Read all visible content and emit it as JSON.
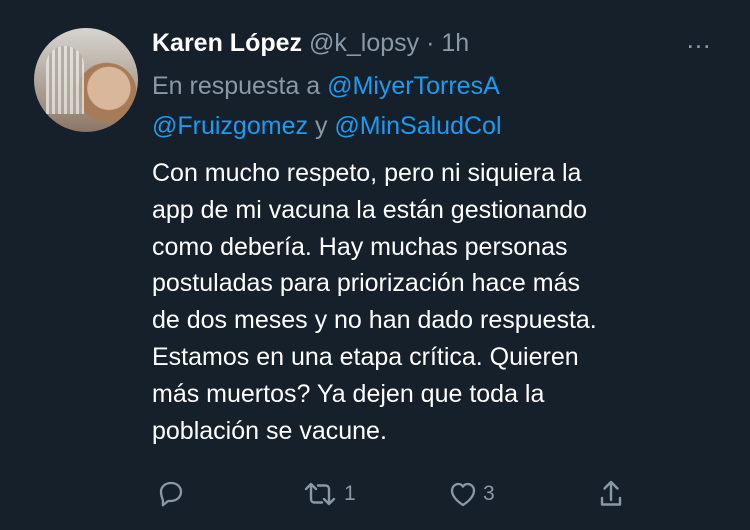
{
  "author": {
    "name": "Karen López",
    "handle": "@k_lopsy",
    "separator": "·",
    "time": "1h"
  },
  "reply_context": {
    "prefix": "En respuesta a",
    "mentions": [
      "@MiyerTorresA",
      "@Fruizgomez",
      "@MinSaludCol"
    ],
    "conjunction": "y"
  },
  "tweet_lines": [
    "Con mucho respeto, pero ni siquiera la",
    "app de mi vacuna la están gestionando",
    "como debería. Hay muchas personas",
    "postuladas para priorización hace más",
    "de dos meses y no han dado respuesta.",
    "Estamos en una etapa crítica. Quieren",
    "más muertos? Ya dejen que toda la",
    "población se vacune."
  ],
  "actions": {
    "reply": {
      "icon": "reply-icon",
      "count": ""
    },
    "retweet": {
      "icon": "retweet-icon",
      "count": "1"
    },
    "like": {
      "icon": "heart-icon",
      "count": "3"
    },
    "share": {
      "icon": "share-icon",
      "count": ""
    }
  },
  "more_menu": {
    "icon": "more-icon",
    "label": "..."
  },
  "colors": {
    "background": "#15202b",
    "text": "#ffffff",
    "muted": "#8b98a5",
    "link": "#1d9bf0"
  }
}
